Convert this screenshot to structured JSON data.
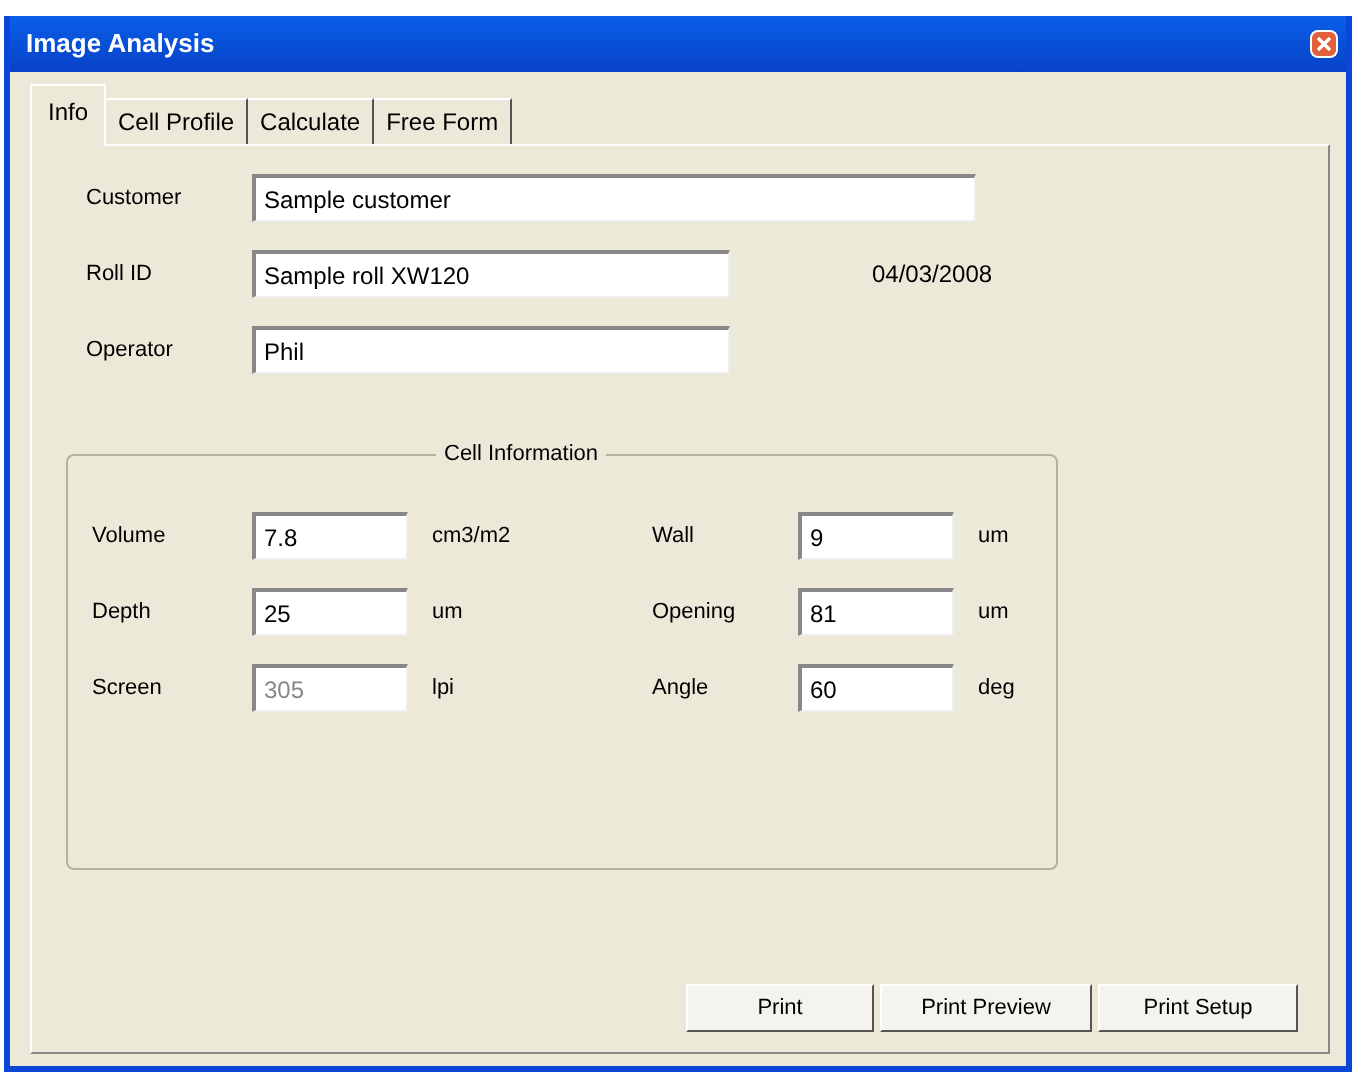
{
  "window": {
    "title": "Image Analysis"
  },
  "tabs": [
    {
      "label": "Info",
      "selected": true
    },
    {
      "label": "Cell Profile",
      "selected": false
    },
    {
      "label": "Calculate",
      "selected": false
    },
    {
      "label": "Free Form",
      "selected": false
    }
  ],
  "customer": {
    "label": "Customer",
    "value": "Sample customer"
  },
  "roll_id": {
    "label": "Roll ID",
    "value": "Sample roll XW120",
    "date": "04/03/2008"
  },
  "operator": {
    "label": "Operator",
    "value": "Phil"
  },
  "cell_information": {
    "title": "Cell Information",
    "fields": [
      {
        "label": "Volume",
        "value": "7.8",
        "unit": "cm3/m2",
        "disabled": false
      },
      {
        "label": "Wall",
        "value": "9",
        "unit": "um",
        "disabled": false
      },
      {
        "label": "Depth",
        "value": "25",
        "unit": "um",
        "disabled": false
      },
      {
        "label": "Opening",
        "value": "81",
        "unit": "um",
        "disabled": false
      },
      {
        "label": "Screen",
        "value": "305",
        "unit": "lpi",
        "disabled": true
      },
      {
        "label": "Angle",
        "value": "60",
        "unit": "deg",
        "disabled": false
      }
    ]
  },
  "buttons": [
    "Print",
    "Print Preview",
    "Print Setup"
  ]
}
